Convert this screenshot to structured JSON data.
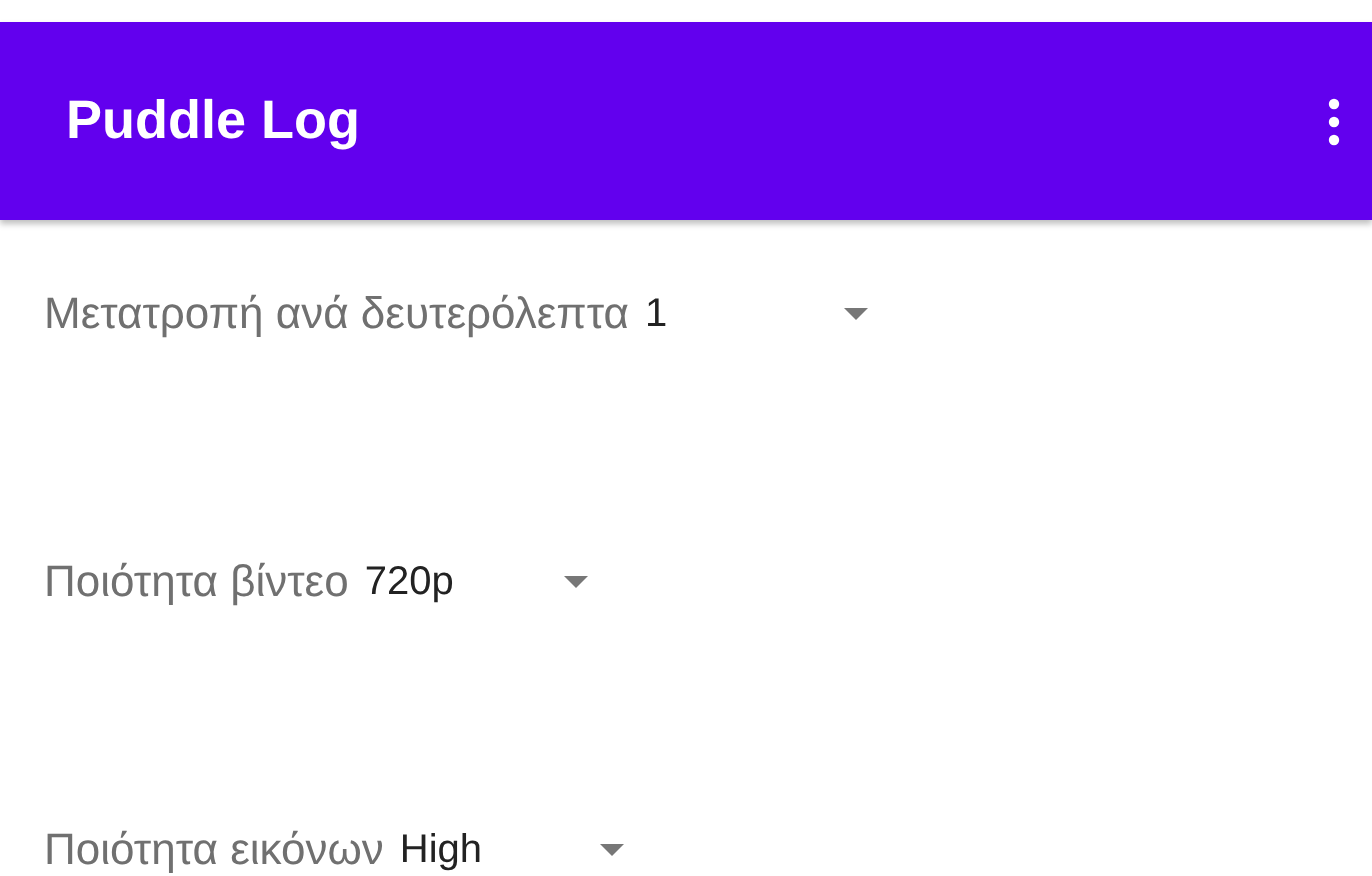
{
  "app_bar": {
    "title": "Puddle Log"
  },
  "settings": [
    {
      "label": "Μετατροπή ανά δευτερόλεπτα",
      "value": "1"
    },
    {
      "label": "Ποιότητα βίντεο",
      "value": "720p"
    },
    {
      "label": "Ποιότητα εικόνων",
      "value": "High"
    }
  ]
}
